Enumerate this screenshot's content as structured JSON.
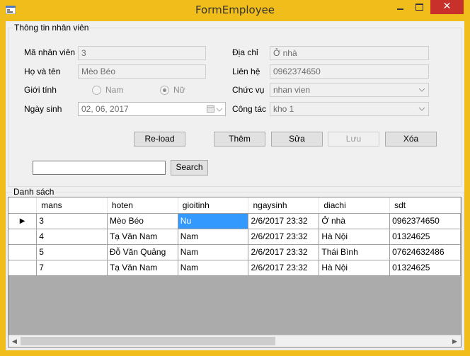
{
  "window": {
    "title": "FormEmployee",
    "close_glyph": "✕"
  },
  "info_group": {
    "legend": "Thông tin nhân viên",
    "ma_label": "Mã nhân viên",
    "ma_value": "3",
    "hoten_label": "Họ và tên",
    "hoten_value": "Mèo Béo",
    "gioitinh_label": "Giới tính",
    "nam_label": "Nam",
    "nu_label": "Nữ",
    "gioitinh_selected": "Nữ",
    "ngaysinh_label": "Ngày sinh",
    "ngaysinh_value": "02, 06, 2017",
    "diachi_label": "Địa chỉ",
    "diachi_value": "Ở nhà",
    "lienhe_label": "Liên hệ",
    "lienhe_value": "0962374650",
    "chucvu_label": "Chức vụ",
    "chucvu_value": "nhan vien",
    "congtac_label": "Công tác",
    "congtac_value": "kho 1"
  },
  "buttons": {
    "reload": "Re-load",
    "them": "Thêm",
    "sua": "Sửa",
    "luu": "Lưu",
    "xoa": "Xóa",
    "search": "Search"
  },
  "search": {
    "value": ""
  },
  "list_group": {
    "legend": "Danh sách"
  },
  "grid": {
    "columns": [
      "mans",
      "hoten",
      "gioitinh",
      "ngaysinh",
      "diachi",
      "sdt"
    ],
    "rows": [
      [
        "3",
        "Mèo Béo",
        "Nu",
        "2/6/2017 23:32",
        "Ở nhà",
        "0962374650"
      ],
      [
        "4",
        "Tạ Văn Nam",
        "Nam",
        "2/6/2017 23:32",
        "Hà Nội",
        "01324625"
      ],
      [
        "5",
        "Đỗ Văn Quảng",
        "Nam",
        "2/6/2017 23:32",
        "Thái Bình",
        "07624632486"
      ],
      [
        "7",
        "Tạ Văn Nam",
        "Nam",
        "2/6/2017 23:32",
        "Hà Nội",
        "01324625"
      ]
    ],
    "current_row_glyph": "▶",
    "selected_cell_row": 0,
    "selected_cell_col": 2
  },
  "scroll": {
    "left_glyph": "◀",
    "right_glyph": "▶"
  },
  "colors": {
    "titlebar": "#f0bd1a",
    "close": "#c7302b",
    "selection": "#3399ff"
  }
}
